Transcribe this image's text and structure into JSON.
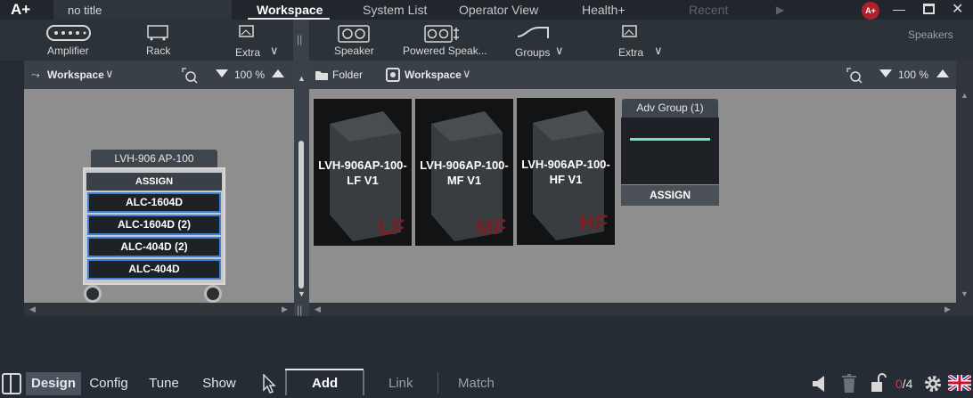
{
  "app": {
    "logo": "A+",
    "doc_title": "no title",
    "badge": "A+"
  },
  "nav": {
    "tabs": [
      {
        "label": "Workspace"
      },
      {
        "label": "System List"
      },
      {
        "label": "Operator View"
      },
      {
        "label": "Health+"
      },
      {
        "label": "Recent"
      }
    ]
  },
  "toolbar": {
    "amplifier": "Amplifier",
    "rack": "Rack",
    "extra_left": "Extra",
    "speaker": "Speaker",
    "powered": "Powered Speak...",
    "groups": "Groups",
    "extra_right": "Extra",
    "speakers_section": "Speakers"
  },
  "left_panel": {
    "view": "Workspace",
    "zoom": "100 %"
  },
  "right_panel": {
    "folder": "Folder",
    "view": "Workspace",
    "zoom": "100 %"
  },
  "rack": {
    "label": "LVH-906 AP-100",
    "assign": "ASSIGN",
    "amps": [
      "ALC-1604D",
      "ALC-1604D (2)",
      "ALC-404D (2)",
      "ALC-404D"
    ]
  },
  "speakers": [
    {
      "line1": "LVH-906AP-100-",
      "line2": "LF V1",
      "band": "LF"
    },
    {
      "line1": "LVH-906AP-100-",
      "line2": "MF V1",
      "band": "MF"
    },
    {
      "line1": "LVH-906AP-100-",
      "line2": "HF V1",
      "band": "HF"
    }
  ],
  "adv_group": {
    "label": "Adv Group (1)",
    "assign": "ASSIGN"
  },
  "bottom": {
    "modes": [
      "Design",
      "Config",
      "Tune",
      "Show"
    ],
    "actions": [
      "Add",
      "Link",
      "Match"
    ],
    "count_current": "0",
    "count_total": "/4"
  },
  "colors": {
    "accent_red": "#b0202a",
    "amp_border": "#3f7fd6",
    "adv_line": "#6fe4c4"
  }
}
